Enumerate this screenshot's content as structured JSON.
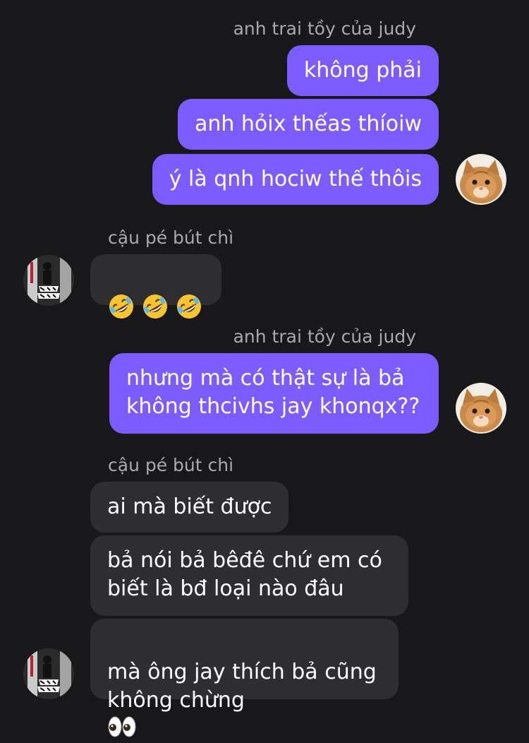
{
  "conversation": {
    "outgoing_sender": "anh trai tồy của judy",
    "incoming_sender": "cậu pé bút chì",
    "groups": [
      {
        "sender": "anh trai tồy của judy",
        "messages": [
          "không phải",
          "anh hỏix thếas thíoiw",
          "ý là qnh hociw thế thôis"
        ]
      },
      {
        "sender": "cậu pé bút chì",
        "messages": [
          "🤣🤣🤣"
        ]
      },
      {
        "sender": "anh trai tồy của judy",
        "messages": [
          "nhưng mà có thật sự là bả\nkhông thcivhs jay khonqx??"
        ]
      },
      {
        "sender": "cậu pé bút chì",
        "messages": [
          "ai mà biết được",
          "bả nói bả bêđê chứ em có\nbiết là bđ loại nào đâu",
          "mà ông jay thích bả cũng\nkhông chừng"
        ]
      }
    ]
  },
  "icons": {
    "outgoing_avatar": "cat-avatar-icon",
    "incoming_avatar": "graffiti-avatar-icon",
    "laugh_emoji": "rolling-on-floor-laughing-emoji",
    "eyes_emoji": "eyes-emoji"
  },
  "colors": {
    "background": "#18181a",
    "outgoing_bubble": "#7c5cff",
    "incoming_bubble": "#2e2e31",
    "sender_label": "#a9a9ae",
    "text": "#ffffff"
  }
}
